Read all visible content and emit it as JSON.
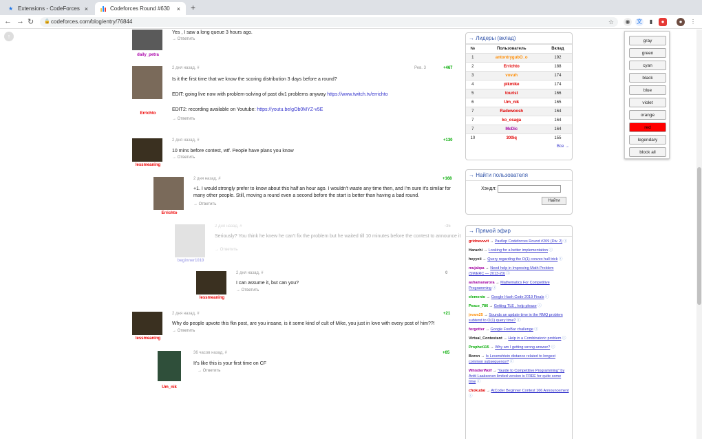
{
  "tabs": [
    {
      "label": "Extensions - CodeForces",
      "close": "×"
    },
    {
      "label": "Codeforces Round #630",
      "close": "×"
    }
  ],
  "newtab": "+",
  "url": "codeforces.com/blog/entry/76844",
  "colors": {
    "accent": "#3355aa",
    "active_color": "#ff0000",
    "red_user": "#e00000",
    "green_vote": "#00aa00"
  },
  "comments": [
    {
      "user": "daily_petra",
      "meta": "",
      "text": "Yes , I saw a long queue 3 hours ago.",
      "reply": "→ Ответить",
      "votes": ""
    },
    {
      "user": "Errichto",
      "meta": "2 дня назад, #",
      "text": "Is it the first time that we know the scoring distribution 3 days before a round?",
      "text2": "EDIT: going live now with problem-solving of past div1 problems anyway",
      "link1": "https://www.twitch.tv/errichto",
      "text3": "EDIT2: recording available on Youtube:",
      "link2": "https://youtu.be/gOb0MYZ-v5E",
      "reply": "→ Ответить",
      "votes": "+467",
      "rev": "Рев. 3"
    },
    {
      "user": "lessmeaning",
      "meta": "2 дня назад, #",
      "text": "10 mins before contest, wtf. People have plans you know",
      "reply": "→ Ответить",
      "votes": "+130"
    },
    {
      "user": "Errichto",
      "meta": "2 дня назад, #",
      "text": "+1. I would strongly prefer to know about this half an hour ago. I wouldn't waste any time then, and I'm sure it's similar for many other people. Still, moving a round even a second before the start is better than having a bad round.",
      "reply": "→ Ответить",
      "votes": "+168"
    },
    {
      "user": "beginner1010",
      "meta": "2 дня назад, #",
      "text": "Seriously? You think he knew he can't fix the problem but he waited till 10 minutes before the contest to announce it",
      "reply": "→ Ответить",
      "votes": "-35"
    },
    {
      "user": "lessmeaning",
      "meta": "2 дня назад, #",
      "text": "I can assume it, but can you?",
      "reply": "→ Ответить",
      "votes": "0"
    },
    {
      "user": "lessmeaning",
      "meta": "2 дня назад, #",
      "text": "Why do people upvote this fkn post, are you insane, is it some kind of cult of Mike, you just in love with every post of him??!",
      "reply": "→ Ответить",
      "votes": "+21"
    },
    {
      "user": "Um_nik",
      "meta": "36 часов назад, #",
      "text": "It's like this is your first time on CF",
      "reply": "→ Ответить",
      "votes": "+65"
    }
  ],
  "leaders": {
    "title": "→ Лидеры (вклад)",
    "headers": [
      "№",
      "Пользователь",
      "Вклад"
    ],
    "rows": [
      [
        "1",
        "antontrygubO_o",
        "192"
      ],
      [
        "2",
        "Errichto",
        "188"
      ],
      [
        "3",
        "vovuh",
        "174"
      ],
      [
        "4",
        "pikmike",
        "174"
      ],
      [
        "5",
        "tourist",
        "166"
      ],
      [
        "6",
        "Um_nik",
        "165"
      ],
      [
        "7",
        "Radewoosh",
        "164"
      ],
      [
        "7",
        "ko_osaga",
        "164"
      ],
      [
        "7",
        "McDic",
        "164"
      ],
      [
        "10",
        "300iq",
        "155"
      ]
    ],
    "more": "Все →"
  },
  "find_user": {
    "title": "→ Найти пользователя",
    "label": "Хэндл:",
    "button": "Найти"
  },
  "live": {
    "title": "→ Прямой эфир",
    "items": [
      {
        "user": "gridnevvvit",
        "topic": "Разбор Codeforces Round #209 (Div. 2)"
      },
      {
        "user": "Harachi",
        "topic": "Looking for a better implementation"
      },
      {
        "user": "heyyeii",
        "topic": "Query regarding the O(1) convex hull trick"
      },
      {
        "user": "mujabpa",
        "topic": "Need help in Improving Math Problem (SWERC — 2013-20)"
      },
      {
        "user": "ashamanarora",
        "topic": "Mathematics For Competitive Programming"
      },
      {
        "user": "elemento",
        "topic": "Google Hash Code 2019 Finals"
      },
      {
        "user": "Peace_786",
        "topic": "Getting TLE , help please"
      },
      {
        "user": "jrvam25",
        "topic": "Sounds an update time in the RMQ problem subtend to O(1) query time?"
      },
      {
        "user": "forgotter",
        "topic": "Google FooBar challenge"
      },
      {
        "user": "Virtual_Contestant",
        "topic": "Help in a Combinatoric problem"
      },
      {
        "user": "Prophet115",
        "topic": "Why am I getting wrong answer?"
      },
      {
        "user": "Boron",
        "topic": "Is Levenshtein distance related to longest common subsequence?"
      },
      {
        "user": "WhistlerWolf",
        "topic": "\"Guide to Competitive Programming\" by Antti Laaksonen limited version is FREE for quite some time"
      },
      {
        "user": "chokudai",
        "topic": "AtCoder Beginner Contest 166 Announcement"
      }
    ]
  },
  "color_menu": {
    "buttons": [
      "gray",
      "green",
      "cyan",
      "black",
      "blue",
      "violet",
      "orange",
      "red",
      "legendary",
      "block all"
    ],
    "active": "red"
  }
}
